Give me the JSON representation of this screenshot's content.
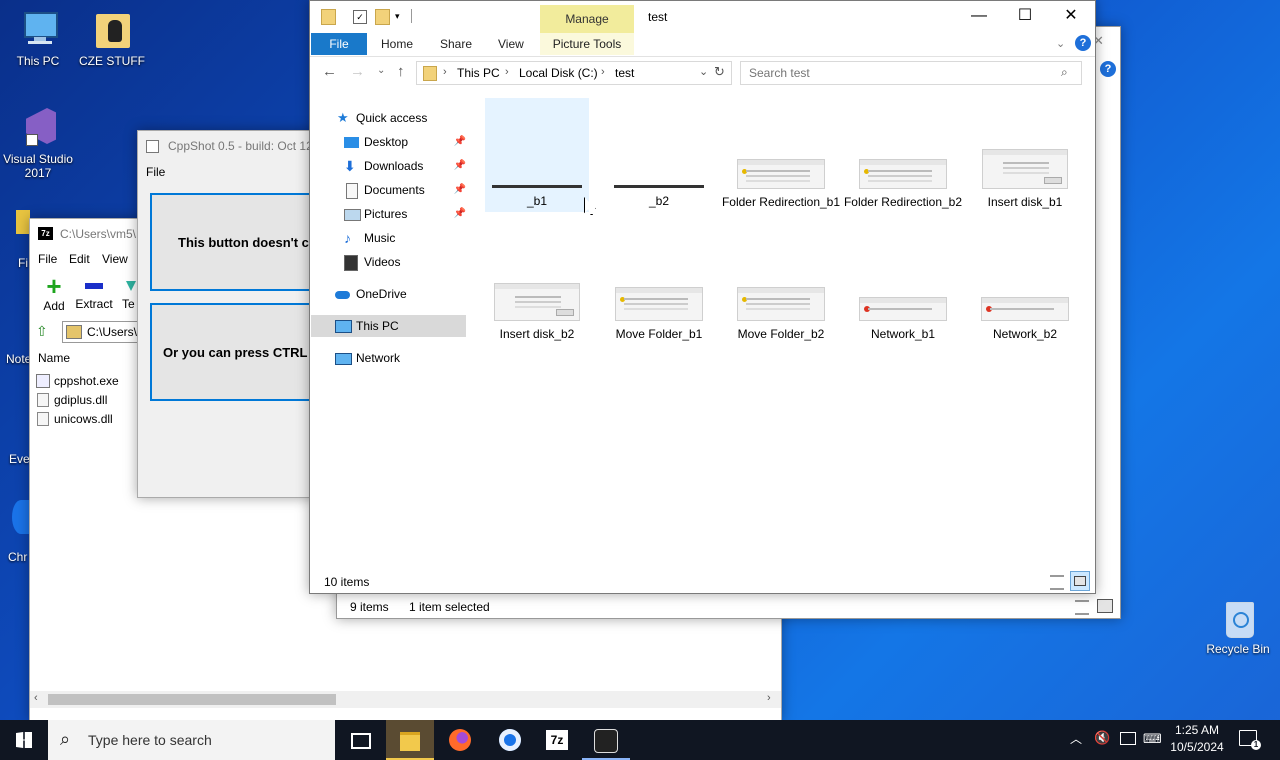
{
  "desktop": {
    "icons": [
      {
        "label": "This PC"
      },
      {
        "label": "CZE STUFF"
      },
      {
        "label": "Visual Studio 2017"
      },
      {
        "label": "Recycle Bin"
      }
    ],
    "partial_labels": [
      "Fi",
      "Note",
      "Eve",
      "Chr"
    ]
  },
  "cppshot": {
    "title": "CppShot 0.5 - build: Oct 12",
    "menu_file": "File",
    "button1": "This button doesn't c",
    "button2": "Or you can press CTRL"
  },
  "sevenzip": {
    "title": "C:\\Users\\vm5\\",
    "menu": [
      "File",
      "Edit",
      "View"
    ],
    "toolbar": [
      "Add",
      "Extract",
      "Te"
    ],
    "path": "C:\\Users\\",
    "column_name": "Name",
    "files": [
      "cppshot.exe",
      "gdiplus.dll",
      "unicows.dll"
    ]
  },
  "explorer_back": {
    "status_count": "9 items",
    "status_selected": "1 item selected"
  },
  "explorer": {
    "title": "test",
    "manage_tab": "Manage",
    "tabs": [
      "File",
      "Home",
      "Share",
      "View",
      "Picture Tools"
    ],
    "breadcrumb": [
      "This PC",
      "Local Disk (C:)",
      "test"
    ],
    "search_placeholder": "Search test",
    "nav": {
      "quick_access": "Quick access",
      "items": [
        "Desktop",
        "Downloads",
        "Documents",
        "Pictures",
        "Music",
        "Videos"
      ],
      "onedrive": "OneDrive",
      "this_pc": "This PC",
      "network": "Network"
    },
    "files": [
      {
        "name": "_b1",
        "style": "strip"
      },
      {
        "name": "_b2",
        "style": "strip"
      },
      {
        "name": "Folder Redirection_b1",
        "style": "warn"
      },
      {
        "name": "Folder Redirection_b2",
        "style": "warn"
      },
      {
        "name": "Insert disk_b1",
        "style": "dialog"
      },
      {
        "name": "Insert disk_b2",
        "style": "dialog"
      },
      {
        "name": "Move Folder_b1",
        "style": "warn"
      },
      {
        "name": "Move Folder_b2",
        "style": "warn"
      },
      {
        "name": "Network_b1",
        "style": "error"
      },
      {
        "name": "Network_b2",
        "style": "error"
      }
    ],
    "status_count": "10 items"
  },
  "taskbar": {
    "search_placeholder": "Type here to search",
    "time": "1:25 AM",
    "date": "10/5/2024"
  },
  "colors": {
    "accent": "#0063b1",
    "manage_tab": "#f2ec9c",
    "selection": "#cce8ff",
    "taskbar": "#101622"
  }
}
